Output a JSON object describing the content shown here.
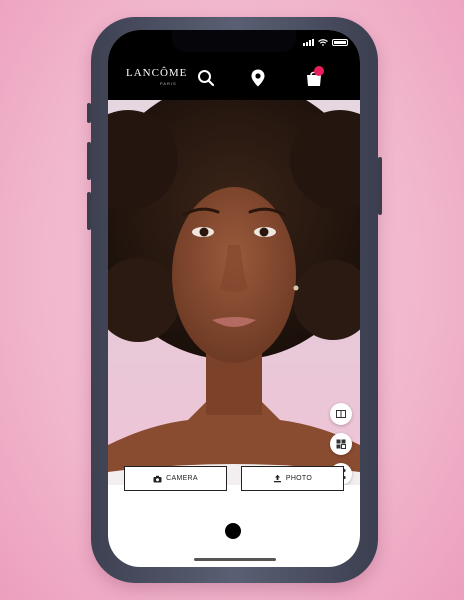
{
  "app": {
    "brand": "LANCÔME",
    "brand_sub": "PARIS"
  },
  "header": {
    "icons": [
      "search-icon",
      "location-pin-icon",
      "bag-icon"
    ]
  },
  "side_tools": [
    "compare-icon",
    "gallery-icon",
    "share-icon"
  ],
  "actions": {
    "camera_label": "CAMERA",
    "photo_label": "PHOTO"
  },
  "colors": {
    "accent": "#e81f5a",
    "background": "#f2b9cf",
    "header": "#000000"
  }
}
